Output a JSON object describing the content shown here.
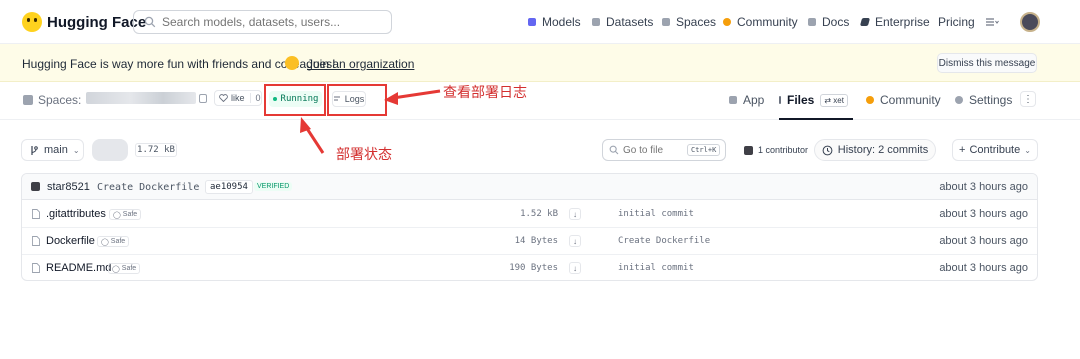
{
  "nav": {
    "brand": "Hugging Face",
    "search_placeholder": "Search models, datasets, users...",
    "items": [
      {
        "label": "Models",
        "color": "#6366f1"
      },
      {
        "label": "Datasets",
        "color": "#ef4444"
      },
      {
        "label": "Spaces",
        "color": "#3b82f6"
      },
      {
        "label": "Community",
        "color": "#f59e0b"
      },
      {
        "label": "Docs",
        "color": "#9ca3af"
      },
      {
        "label": "Enterprise",
        "color": "#111827"
      },
      {
        "label": "Pricing",
        "color": ""
      }
    ],
    "menu_icon": "list-icon"
  },
  "banner": {
    "text": "Hugging Face is way more fun with friends and colleagues!",
    "link": "Join an organization",
    "dismiss": "Dismiss this message"
  },
  "space": {
    "label": "Spaces:",
    "like": "like",
    "like_count": "0",
    "status": "Running",
    "logs": "Logs"
  },
  "annotations": {
    "logs_note": "查看部署日志",
    "status_note": "部署状态",
    "color": "#e53935"
  },
  "tabs": [
    {
      "label": "App"
    },
    {
      "label": "Files",
      "badge": "xet",
      "active": true
    },
    {
      "label": "Community"
    },
    {
      "label": "Settings"
    }
  ],
  "repo": {
    "branch": "main",
    "size": "1.72 kB",
    "goto_placeholder": "Go to file",
    "goto_kbd": "Ctrl+K",
    "contributors": "1 contributor",
    "history": "History: 2 commits",
    "contribute": "Contribute"
  },
  "last_commit": {
    "author": "star8521",
    "message": "Create Dockerfile",
    "hash": "ae10954",
    "verified": "VERIFIED",
    "time": "about 3 hours ago"
  },
  "files": [
    {
      "name": ".gitattributes",
      "safe": "Safe",
      "size": "1.52 kB",
      "commit": "initial commit",
      "time": "about 3 hours ago"
    },
    {
      "name": "Dockerfile",
      "safe": "Safe",
      "size": "14 Bytes",
      "commit": "Create Dockerfile",
      "time": "about 3 hours ago"
    },
    {
      "name": "README.md",
      "safe": "Safe",
      "size": "190 Bytes",
      "commit": "initial commit",
      "time": "about 3 hours ago"
    }
  ]
}
